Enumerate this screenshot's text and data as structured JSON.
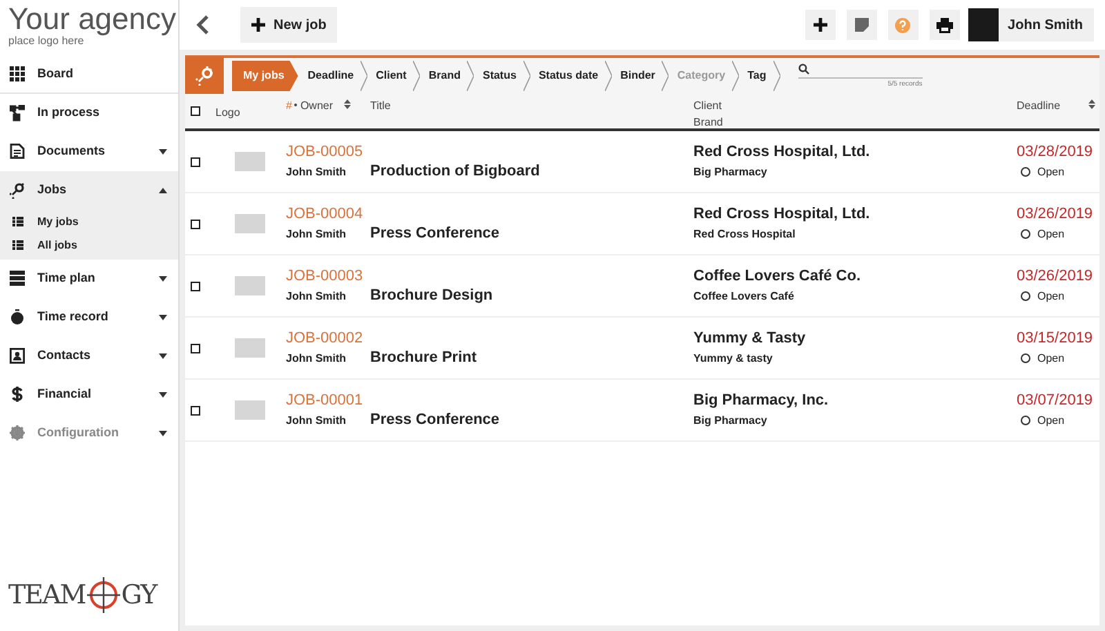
{
  "brand": {
    "title": "Your agency",
    "subtitle": "place logo here"
  },
  "toolbar": {
    "new_button": "New job",
    "user": "John Smith"
  },
  "sidebar": {
    "items": [
      {
        "label": "Board",
        "selected": false,
        "disabled": false
      },
      {
        "label": "In process",
        "selected": false,
        "disabled": false
      },
      {
        "label": "Documents",
        "expanded": false,
        "selected": false,
        "disabled": false
      },
      {
        "label": "Jobs",
        "expanded": true,
        "selected": true,
        "disabled": false,
        "children": [
          {
            "label": "My jobs"
          },
          {
            "label": "All jobs"
          }
        ]
      },
      {
        "label": "Time plan",
        "expanded": false,
        "selected": false,
        "disabled": false
      },
      {
        "label": "Time record",
        "expanded": false,
        "selected": false,
        "disabled": false
      },
      {
        "label": "Contacts",
        "expanded": false,
        "selected": false,
        "disabled": false
      },
      {
        "label": "Financial",
        "expanded": false,
        "selected": false,
        "disabled": false
      },
      {
        "label": "Configuration",
        "expanded": false,
        "selected": false,
        "disabled": true
      }
    ],
    "footer_logo": {
      "left": "TEAM",
      "right": "GY"
    }
  },
  "filters": {
    "tabs": [
      {
        "label": "My jobs",
        "selected": true,
        "disabled": false
      },
      {
        "label": "Deadline",
        "selected": false,
        "disabled": false
      },
      {
        "label": "Client",
        "selected": false,
        "disabled": false
      },
      {
        "label": "Brand",
        "selected": false,
        "disabled": false
      },
      {
        "label": "Status",
        "selected": false,
        "disabled": false
      },
      {
        "label": "Status date",
        "selected": false,
        "disabled": false
      },
      {
        "label": "Binder",
        "selected": false,
        "disabled": false
      },
      {
        "label": "Category",
        "selected": false,
        "disabled": true
      },
      {
        "label": "Tag",
        "selected": false,
        "disabled": false
      }
    ],
    "records": "5/5 records"
  },
  "table": {
    "select_all_checked": false,
    "columns": {
      "logo": "Logo",
      "number": "#",
      "owner": "Owner",
      "title": "Title",
      "client": "Client",
      "brand": "Brand",
      "deadline": "Deadline"
    },
    "rows": [
      {
        "checked": false,
        "number": "JOB-00005",
        "owner": "John Smith",
        "title": "Production of Bigboard",
        "client": "Red Cross Hospital, Ltd.",
        "brand": "Big Pharmacy",
        "deadline": "03/28/2019",
        "status": "Open"
      },
      {
        "checked": false,
        "number": "JOB-00004",
        "owner": "John Smith",
        "title": "Press Conference",
        "client": "Red Cross Hospital, Ltd.",
        "brand": "Red Cross Hospital",
        "deadline": "03/26/2019",
        "status": "Open"
      },
      {
        "checked": false,
        "number": "JOB-00003",
        "owner": "John Smith",
        "title": "Brochure Design",
        "client": "Coffee Lovers Café Co.",
        "brand": "Coffee Lovers Café",
        "deadline": "03/26/2019",
        "status": "Open"
      },
      {
        "checked": false,
        "number": "JOB-00002",
        "owner": "John Smith",
        "title": "Brochure Print",
        "client": "Yummy & Tasty",
        "brand": "Yummy & tasty",
        "deadline": "03/15/2019",
        "status": "Open"
      },
      {
        "checked": false,
        "number": "JOB-00001",
        "owner": "John Smith",
        "title": "Press Conference",
        "client": "Big Pharmacy, Inc.",
        "brand": "Big Pharmacy",
        "deadline": "03/07/2019",
        "status": "Open"
      }
    ]
  }
}
